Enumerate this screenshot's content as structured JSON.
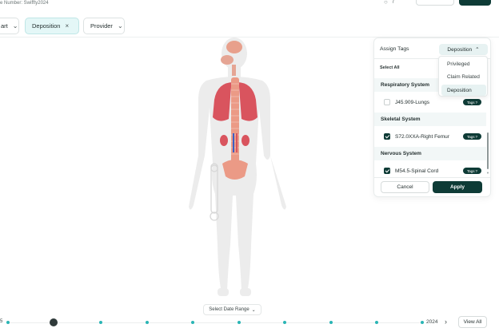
{
  "header": {
    "case_number": "e Number: Swiffty2024",
    "icon": "info-icon",
    "icon_label": "r"
  },
  "filters": {
    "chips": [
      {
        "label": "art",
        "icon": "chevron-down-icon"
      },
      {
        "label": "Deposition",
        "icon": "close-icon",
        "active": true
      },
      {
        "label": "Provider",
        "icon": "chevron-down-icon"
      }
    ]
  },
  "body_map": {
    "highlighted": [
      "brain",
      "lungs",
      "spine",
      "kidneys",
      "right-femur"
    ]
  },
  "date_range": {
    "label": "Select Date Range",
    "icon": "chevron-down-icon"
  },
  "timeline": {
    "start_label": "5",
    "end_label": "2024",
    "next_icon": "chevron-right-icon",
    "view_all_label": "View All"
  },
  "tags_panel": {
    "title": "Assign Tags",
    "selected_tag": "Deposition",
    "select_all_label": "Select All",
    "dropdown_options": [
      "Privileged",
      "Claim Related",
      "Deposition"
    ],
    "groups": [
      {
        "name": "Respiratory System",
        "items": [
          {
            "label": "J45.909-Lungs",
            "checked": false,
            "tag": "Tags"
          }
        ]
      },
      {
        "name": "Skeletal System",
        "items": [
          {
            "label": "S72.0XXA-Right Femur",
            "checked": true,
            "tag": "Tags"
          }
        ]
      },
      {
        "name": "Nervous System",
        "items": [
          {
            "label": "M54.5-Spinal Cord",
            "checked": true,
            "tag": "Tags"
          }
        ]
      }
    ],
    "cancel_label": "Cancel",
    "apply_label": "Apply"
  },
  "colors": {
    "primary_dark": "#0e3b36",
    "accent_teal": "#2ab5b5",
    "active_chip_bg": "#e4f7f7",
    "organ_red": "#d9545e",
    "spine_salmon": "#eb9a86"
  }
}
